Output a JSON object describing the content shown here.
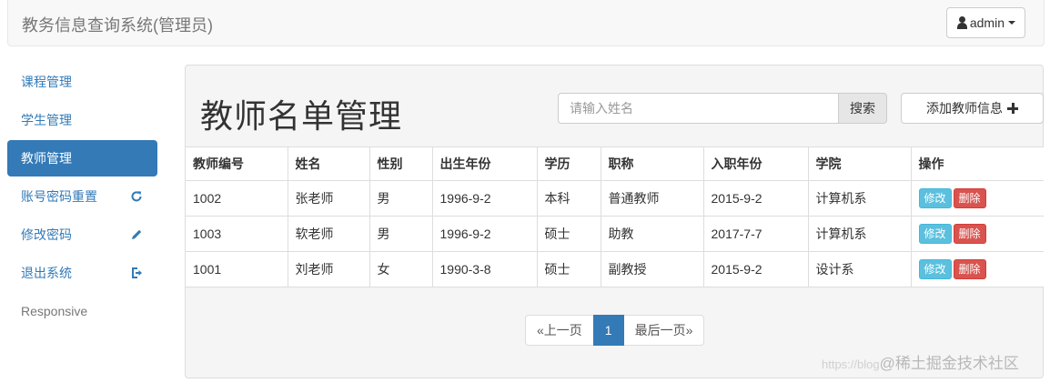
{
  "navbar": {
    "brand": "教务信息查询系统(管理员)",
    "user_label": "admin"
  },
  "sidebar": {
    "items": [
      {
        "label": "课程管理",
        "icon": ""
      },
      {
        "label": "学生管理",
        "icon": ""
      },
      {
        "label": "教师管理",
        "icon": "",
        "active": true
      },
      {
        "label": "账号密码重置",
        "icon": "refresh-icon"
      },
      {
        "label": "修改密码",
        "icon": "pencil-icon"
      },
      {
        "label": "退出系统",
        "icon": "logout-icon"
      },
      {
        "label": "Responsive",
        "icon": ""
      }
    ]
  },
  "main": {
    "title": "教师名单管理",
    "search": {
      "placeholder": "请输入姓名",
      "button_label": "搜索"
    },
    "add_button_label": "添加教师信息",
    "table": {
      "headers": [
        "教师编号",
        "姓名",
        "性别",
        "出生年份",
        "学历",
        "职称",
        "入职年份",
        "学院",
        "操作"
      ],
      "rows": [
        [
          "1002",
          "张老师",
          "男",
          "1996-9-2",
          "本科",
          "普通教师",
          "2015-9-2",
          "计算机系"
        ],
        [
          "1003",
          "软老师",
          "男",
          "1996-9-2",
          "硕士",
          "助教",
          "2017-7-7",
          "计算机系"
        ],
        [
          "1001",
          "刘老师",
          "女",
          "1990-3-8",
          "硕士",
          "副教授",
          "2015-9-2",
          "设计系"
        ]
      ],
      "edit_label": "修改",
      "delete_label": "删除"
    },
    "pagination": {
      "prev_label": "«上一页",
      "current_page": "1",
      "last_label": "最后一页»"
    }
  },
  "watermark": {
    "url_text": "https://blog",
    "brand_text": "@稀土掘金技术社区"
  },
  "colors": {
    "primary": "#337ab7",
    "info": "#5bc0de",
    "danger": "#d9534f"
  }
}
